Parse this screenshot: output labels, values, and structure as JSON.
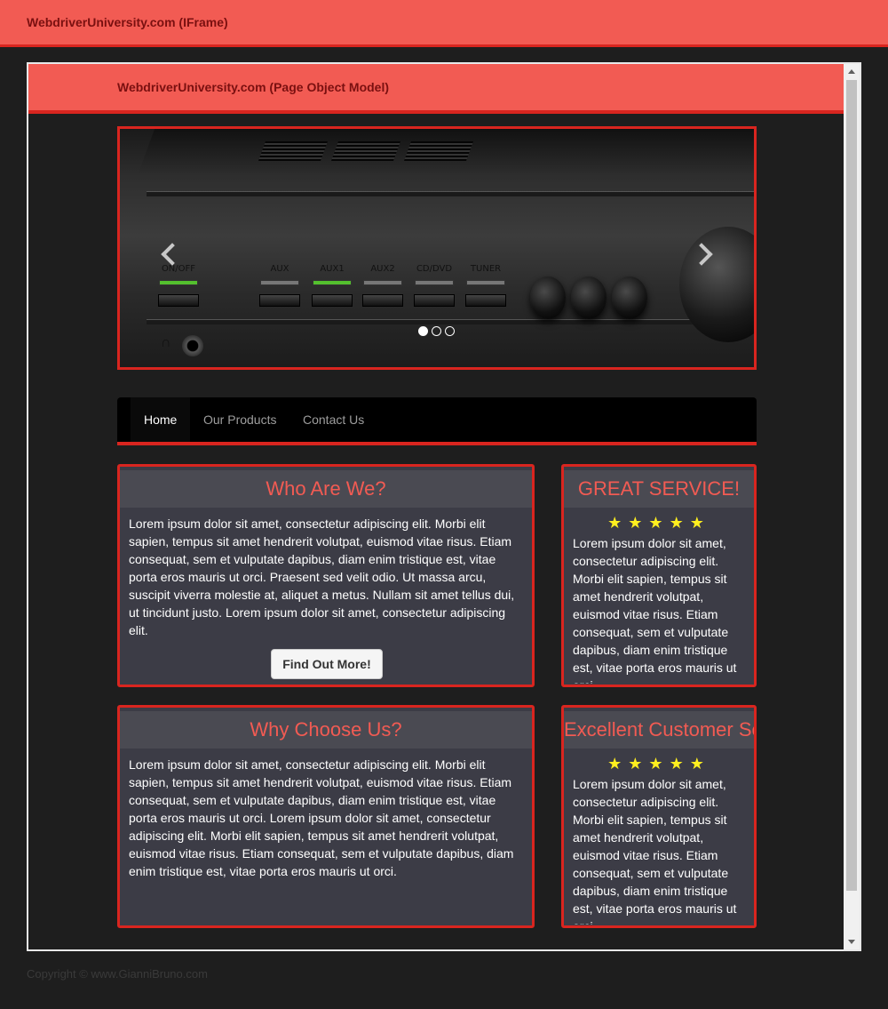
{
  "outer": {
    "title": "WebdriverUniversity.com (IFrame)"
  },
  "inner": {
    "title": "WebdriverUniversity.com (Page Object Model)"
  },
  "carousel": {
    "labels": [
      "ON/OFF",
      "AUX",
      "AUX1",
      "AUX2",
      "CD/DVD",
      "TUNER"
    ],
    "prev_icon": "chevron-left-icon",
    "next_icon": "chevron-right-icon",
    "active_slide": 1,
    "slide_count": 3
  },
  "nav": {
    "items": [
      {
        "label": "Home",
        "active": true
      },
      {
        "label": "Our Products",
        "active": false
      },
      {
        "label": "Contact Us",
        "active": false
      }
    ]
  },
  "panels": {
    "who": {
      "title": "Who Are We?",
      "body": "Lorem ipsum dolor sit amet, consectetur adipiscing elit. Morbi elit sapien, tempus sit amet hendrerit volutpat, euismod vitae risus. Etiam consequat, sem et vulputate dapibus, diam enim tristique est, vitae porta eros mauris ut orci. Praesent sed velit odio. Ut massa arcu, suscipit viverra molestie at, aliquet a metus. Nullam sit amet tellus dui, ut tincidunt justo. Lorem ipsum dolor sit amet, consectetur adipiscing elit.",
      "button": "Find Out More!"
    },
    "great": {
      "title": "GREAT SERVICE!",
      "stars": "★★★★★",
      "body": "Lorem ipsum dolor sit amet, consectetur adipiscing elit. Morbi elit sapien, tempus sit amet hendrerit volutpat, euismod vitae risus. Etiam consequat, sem et vulputate dapibus, diam enim tristique est, vitae porta eros mauris ut orci."
    },
    "why": {
      "title": "Why Choose Us?",
      "body": "Lorem ipsum dolor sit amet, consectetur adipiscing elit. Morbi elit sapien, tempus sit amet hendrerit volutpat, euismod vitae risus. Etiam consequat, sem et vulputate dapibus, diam enim tristique est, vitae porta eros mauris ut orci. Lorem ipsum dolor sit amet, consectetur adipiscing elit. Morbi elit sapien, tempus sit amet hendrerit volutpat, euismod vitae risus. Etiam consequat, sem et vulputate dapibus, diam enim tristique est, vitae porta eros mauris ut orci."
    },
    "excellent": {
      "title": "Excellent Customer Service!",
      "stars": "★★★★★",
      "body": "Lorem ipsum dolor sit amet, consectetur adipiscing elit. Morbi elit sapien, tempus sit amet hendrerit volutpat, euismod vitae risus. Etiam consequat, sem et vulputate dapibus, diam enim tristique est, vitae porta eros mauris ut orci."
    }
  },
  "footer": {
    "text": "Copyright © www.GianniBruno.com"
  },
  "colors": {
    "accent": "#f25b53",
    "accent_dark": "#d9251f",
    "panel_bg": "#3c3c46",
    "page_bg": "#1e1e1e",
    "star": "#ffef1f"
  }
}
